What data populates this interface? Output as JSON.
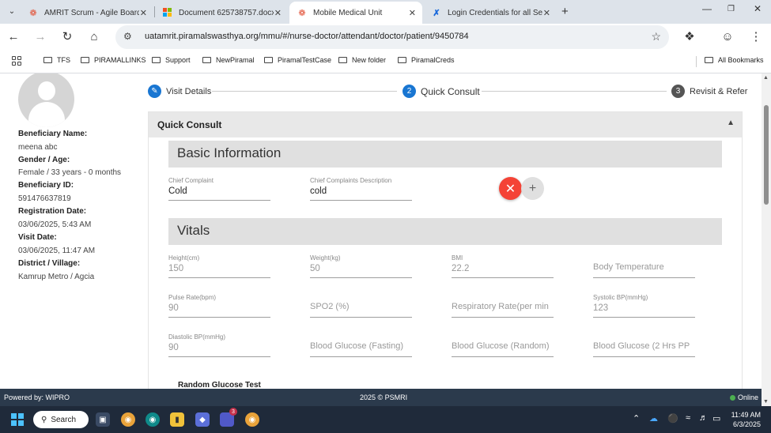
{
  "browser": {
    "tabs": [
      {
        "label": "AMRIT Scrum - Agile Board",
        "icon": "jira-icon"
      },
      {
        "label": "Document 625738757.docx",
        "icon": "word-icon"
      },
      {
        "label": "Mobile Medical Unit",
        "icon": "mmu-icon",
        "active": true
      },
      {
        "label": "Login Credentials for all Ser",
        "icon": "confluence-icon"
      }
    ],
    "url": "uatamrit.piramalswasthya.org/mmu/#/nurse-doctor/attendant/doctor/patient/9450784",
    "bookmarks": [
      "TFS",
      "PIRAMALLINKS",
      "Support",
      "NewPiramal",
      "PiramalTestCase",
      "New folder",
      "PiramalCreds"
    ],
    "all_bookmarks": "All Bookmarks"
  },
  "beneficiary": {
    "name_label": "Beneficiary Name:",
    "name": "meena abc",
    "gender_age_label": "Gender / Age:",
    "gender_age": "Female / 33 years - 0 months",
    "id_label": "Beneficiary ID:",
    "id": "591476637819",
    "registration_label": "Registration Date:",
    "registration": "03/06/2025, 5:43 AM",
    "visit_label": "Visit Date:",
    "visit": "03/06/2025, 11:47 AM",
    "district_label": "District / Village:",
    "district": "Kamrup Metro / Agcia"
  },
  "stepper": {
    "step1": "Visit Details",
    "step2_num": "2",
    "step2": "Quick Consult",
    "step3_num": "3",
    "step3": "Revisit & Refer"
  },
  "panel": {
    "title": "Quick Consult",
    "basic_info": "Basic Information",
    "chief_complaint_label": "Chief Complaint",
    "chief_complaint": "Cold",
    "chief_desc_label": "Chief Complaints Description",
    "chief_desc": "cold",
    "vitals": "Vitals",
    "height_label": "Height(cm)",
    "height": "150",
    "weight_label": "Weight(kg)",
    "weight": "50",
    "bmi_label": "BMI",
    "bmi": "22.2",
    "body_temp": "Body Temperature",
    "pulse_label": "Pulse Rate(bpm)",
    "pulse": "90",
    "spo2": "SPO2 (%)",
    "resp_rate": "Respiratory Rate(per min",
    "systolic_label": "Systolic BP(mmHg)",
    "systolic": "123",
    "diastolic_label": "Diastolic BP(mmHg)",
    "diastolic": "90",
    "bg_fasting": "Blood Glucose (Fasting)",
    "bg_random": "Blood Glucose (Random)",
    "bg_2hrs": "Blood Glucose (2 Hrs PP",
    "random_glucose_test": "Random Glucose Test"
  },
  "footer": {
    "powered": "Powered by: WIPRO",
    "copyright": "2025 © PSMRI",
    "status": "Online"
  },
  "taskbar": {
    "search": "Search",
    "teams_badge": "3",
    "time": "11:49 AM",
    "date": "6/3/2025"
  },
  "colors": {
    "remove": "#f44336",
    "step_done": "#1976d2",
    "step_active": "#1976d2",
    "step_pending": "#555555",
    "footer_bg": "#2b3a4c",
    "online": "#4caf50"
  }
}
